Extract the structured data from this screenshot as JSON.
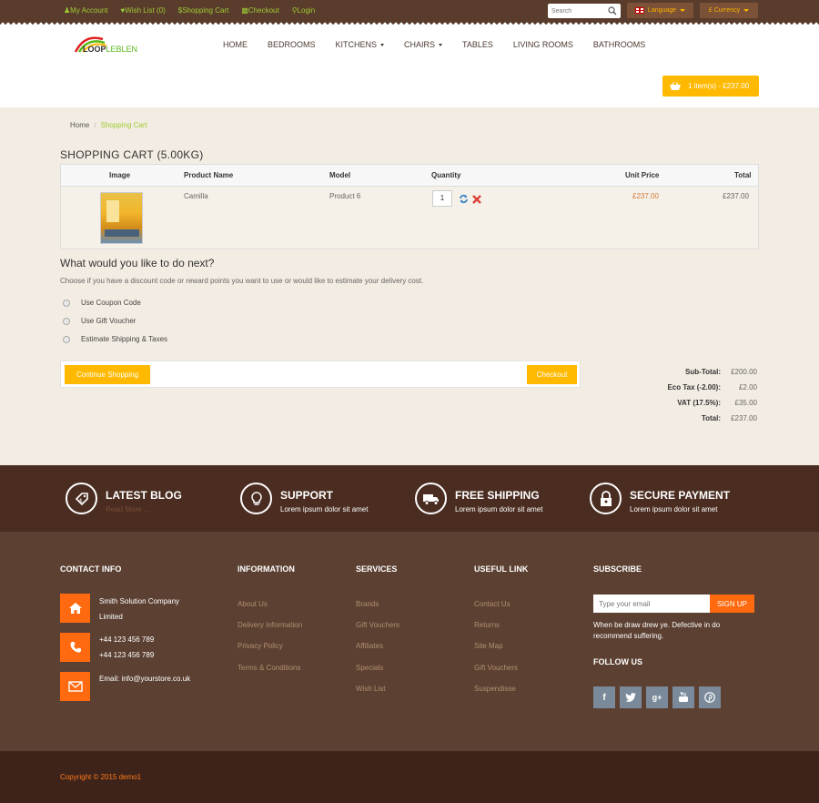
{
  "topbar": {
    "links": [
      "My Account",
      "Wish List (0)",
      "Shopping Cart",
      "Checkout",
      "Login"
    ],
    "search_placeholder": "Search",
    "language_label": "Language",
    "currency_label": "£ Currency"
  },
  "header": {
    "logo_part1": "LOOP",
    "logo_part2": "LEBLEN",
    "nav": [
      "HOME",
      "BEDROOMS",
      "KITCHENS",
      "CHAIRS",
      "TABLES",
      "LIVING ROOMS",
      "BATHROOMS"
    ],
    "cart_label": "1 item(s) - £237.00"
  },
  "breadcrumb": {
    "home": "Home",
    "separator": "/",
    "current": "Shopping Cart"
  },
  "cart": {
    "title": "SHOPPING CART  (5.00KG)",
    "headers": {
      "image": "Image",
      "name": "Product Name",
      "model": "Model",
      "quantity": "Quantity",
      "unit_price": "Unit Price",
      "total": "Total"
    },
    "row": {
      "name": "Camilla",
      "model": "Product 6",
      "quantity": "1",
      "unit_price": "£237.00",
      "total": "£237.00"
    }
  },
  "next": {
    "title": "What would you like to do next?",
    "description": "Choose if you have a discount code or reward points you want to use or would like to estimate your delivery cost.",
    "options": [
      "Use Coupon Code",
      "Use Gift Voucher",
      "Estimate Shipping & Taxes"
    ]
  },
  "buttons": {
    "continue": "Continue Shopping",
    "checkout": "Checkout"
  },
  "totals": [
    {
      "label": "Sub-Total:",
      "value": "£200.00"
    },
    {
      "label": "Eco Tax (-2.00):",
      "value": "£2.00"
    },
    {
      "label": "VAT (17.5%):",
      "value": "£35.00"
    },
    {
      "label": "Total:",
      "value": "£237.00"
    }
  ],
  "features": [
    {
      "title": "LATEST BLOG",
      "subtitle": "Read More ..."
    },
    {
      "title": "SUPPORT",
      "subtitle": "Lorem ipsum dolor sit amet"
    },
    {
      "title": "FREE SHIPPING",
      "subtitle": "Lorem ipsum dolor sit amet"
    },
    {
      "title": "SECURE PAYMENT",
      "subtitle": "Lorem ipsum dolor sit amet"
    }
  ],
  "footer": {
    "contact_heading": "CONTACT INFO",
    "company_line1": "Smith Solution Company",
    "company_line2": "Limited",
    "phone1": "+44 123 456 789",
    "phone2": "+44 123 456 789",
    "email": "Email: info@yourstore.co.uk",
    "information_heading": "INFORMATION",
    "information_links": [
      "About Us",
      "Delivery Information",
      "Privacy Policy",
      "Terms & Conditions"
    ],
    "services_heading": "SERVICES",
    "services_links": [
      "Brands",
      "Gift Vouchers",
      "Affiliates",
      "Specials",
      "Wish List"
    ],
    "useful_heading": "USEFUL LINK",
    "useful_links": [
      "Contact Us",
      "Returns",
      "Site Map",
      "Gift Vouchers",
      "Suspendisse"
    ],
    "subscribe_heading": "SUBSCRIBE",
    "subscribe_placeholder": "Type your email",
    "subscribe_button": "SIGN UP",
    "subscribe_desc": "When be draw drew ye. Defective in do recommend suffering.",
    "follow_heading": "FOLLOW US",
    "social": [
      "f",
      "t",
      "g+",
      "yt",
      "p"
    ]
  },
  "copyright": "Copyright © 2015 demo1",
  "colors": {
    "accent": "#ffb900",
    "orange": "#ff6a10",
    "brown_dark": "#4a2c20",
    "brown": "#5c4032",
    "green": "#9ccc33"
  }
}
